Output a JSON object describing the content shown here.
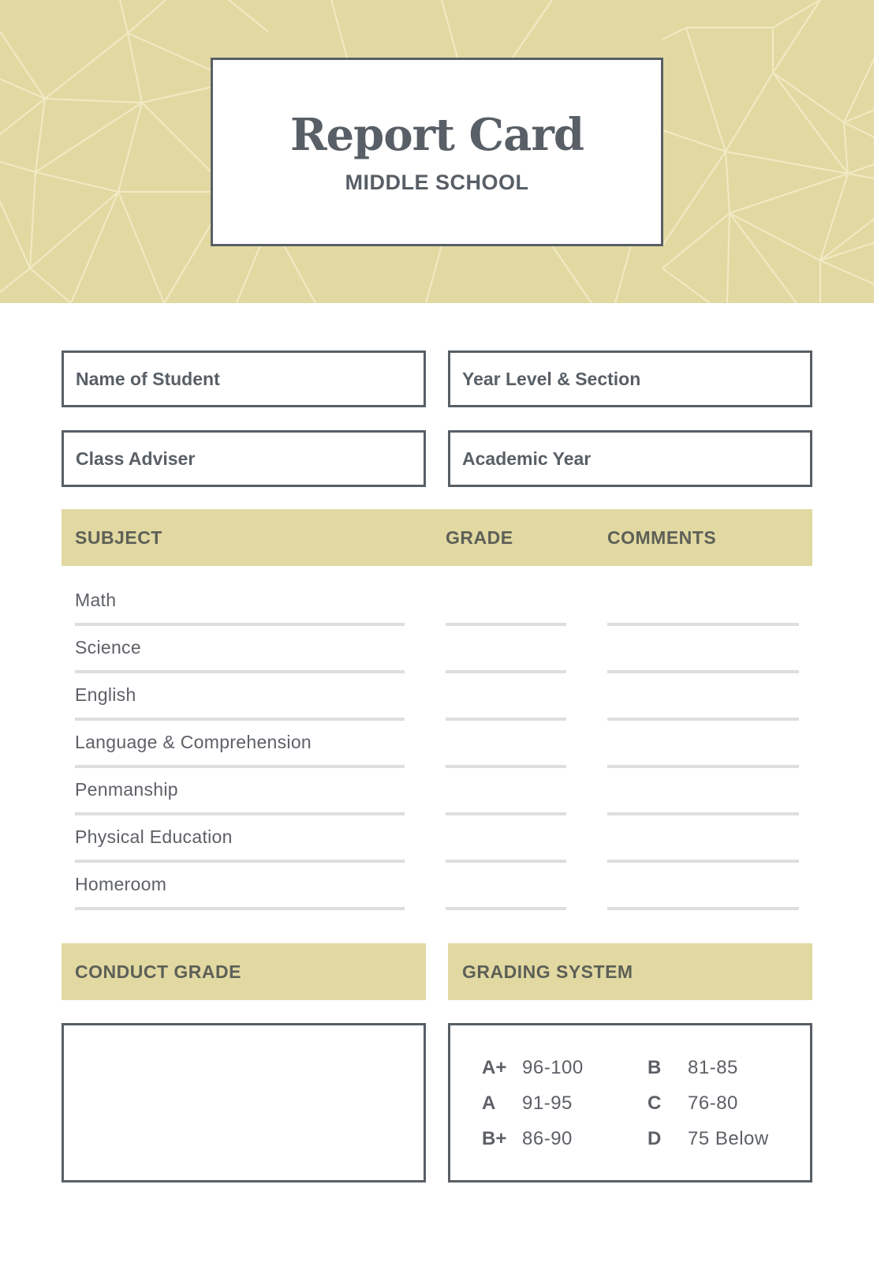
{
  "header": {
    "title": "Report Card",
    "subtitle": "MIDDLE SCHOOL"
  },
  "info_fields": [
    {
      "label": "Name of Student",
      "value": ""
    },
    {
      "label": "Year Level & Section",
      "value": ""
    },
    {
      "label": "Class Adviser",
      "value": ""
    },
    {
      "label": "Academic Year",
      "value": ""
    }
  ],
  "grades_table": {
    "columns": [
      "SUBJECT",
      "GRADE",
      "COMMENTS"
    ],
    "rows": [
      {
        "subject": "Math",
        "grade": "",
        "comments": ""
      },
      {
        "subject": "Science",
        "grade": "",
        "comments": ""
      },
      {
        "subject": "English",
        "grade": "",
        "comments": ""
      },
      {
        "subject": "Language & Comprehension",
        "grade": "",
        "comments": ""
      },
      {
        "subject": "Penmanship",
        "grade": "",
        "comments": ""
      },
      {
        "subject": "Physical Education",
        "grade": "",
        "comments": ""
      },
      {
        "subject": "Homeroom",
        "grade": "",
        "comments": ""
      }
    ]
  },
  "conduct_grade": {
    "heading": "CONDUCT GRADE",
    "value": ""
  },
  "grading_system": {
    "heading": "GRADING SYSTEM",
    "entries": [
      {
        "grade": "A+",
        "range": "96-100"
      },
      {
        "grade": "A",
        "range": "91-95"
      },
      {
        "grade": "B+",
        "range": "86-90"
      },
      {
        "grade": "B",
        "range": "81-85"
      },
      {
        "grade": "C",
        "range": "76-80"
      },
      {
        "grade": "D",
        "range": "75 Below"
      }
    ]
  },
  "colors": {
    "accent": "#e2d9a2",
    "border": "#585f66",
    "text": "#585f66",
    "rule": "#dedede"
  }
}
